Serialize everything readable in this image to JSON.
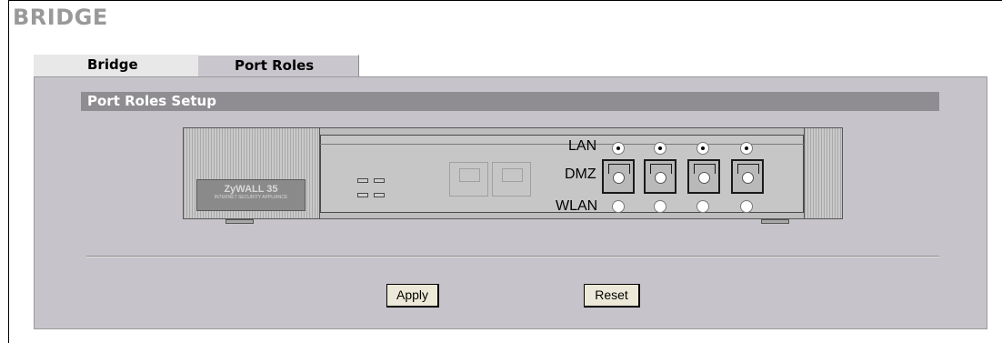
{
  "page": {
    "title": "BRIDGE"
  },
  "tabs": [
    {
      "label": "Bridge"
    },
    {
      "label": "Port Roles"
    }
  ],
  "section": {
    "title": "Port Roles Setup"
  },
  "device": {
    "logo_text": "ZyWALL 35",
    "logo_subtext": "INTERNET SECURITY APPLIANCE"
  },
  "port_roles": {
    "row_labels": [
      "LAN",
      "DMZ",
      "WLAN"
    ],
    "lan_selected": [
      true,
      true,
      true,
      true
    ],
    "wlan_selected": [
      false,
      false,
      false,
      false
    ]
  },
  "buttons": {
    "apply": "Apply",
    "reset": "Reset"
  }
}
